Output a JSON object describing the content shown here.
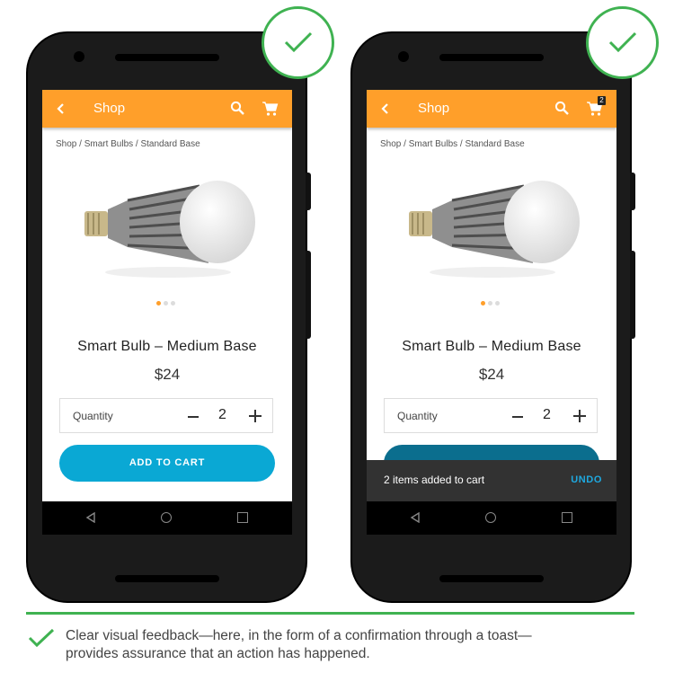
{
  "colors": {
    "appbar": "#ff9f2a",
    "accent_blue": "#0aa8d4",
    "success_green": "#3fb251",
    "toast_bg": "#323232",
    "undo": "#1ea9e0"
  },
  "icons": [
    "back-arrow-icon",
    "search-icon",
    "cart-icon",
    "check-icon",
    "nav-back-icon",
    "nav-home-icon",
    "nav-recent-icon"
  ],
  "screens": [
    {
      "appbar": {
        "title": "Shop"
      },
      "breadcrumb": "Shop / Smart Bulbs / Standard Base",
      "product": {
        "title": "Smart Bulb – Medium Base",
        "price": "$24"
      },
      "quantity": {
        "label": "Quantity",
        "value": "2"
      },
      "add_to_cart": "ADD TO CART"
    },
    {
      "appbar": {
        "title": "Shop",
        "cart_badge": "2"
      },
      "breadcrumb": "Shop / Smart Bulbs / Standard Base",
      "product": {
        "title": "Smart Bulb – Medium Base",
        "price": "$24"
      },
      "quantity": {
        "label": "Quantity",
        "value": "2"
      },
      "toast": {
        "message": "2 items added to cart",
        "action": "UNDO"
      }
    }
  ],
  "caption": "Clear visual feedback—here, in the form of a confirmation through a toast—provides assurance that an action has happened."
}
